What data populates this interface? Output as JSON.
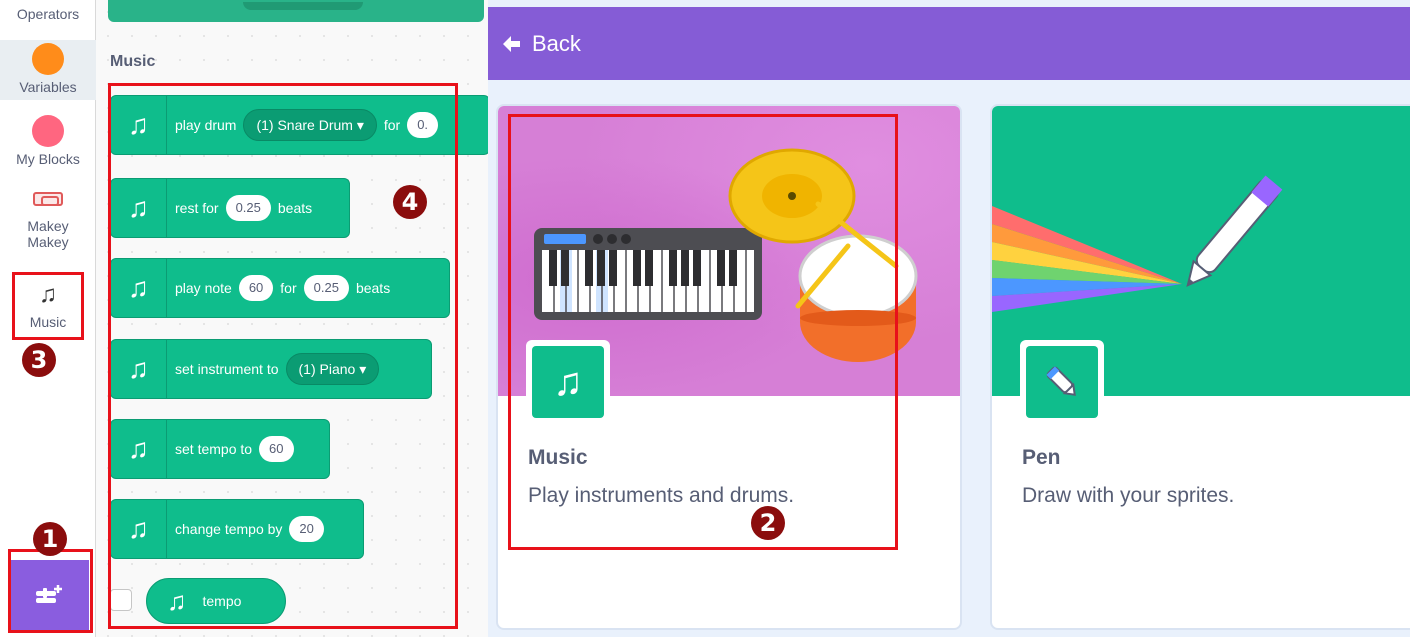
{
  "categories": {
    "operators": {
      "label": "Operators"
    },
    "variables": {
      "label": "Variables",
      "color": "#ff8c1a"
    },
    "my_blocks": {
      "label": "My Blocks",
      "color": "#ff6680"
    },
    "makey_makey": {
      "label": "Makey\nMakey",
      "line1": "Makey",
      "line2": "Makey"
    },
    "music": {
      "label": "Music",
      "icon": "music-notes-icon"
    }
  },
  "palette": {
    "section_heading": "Music",
    "blocks": {
      "play_drum": {
        "label": "play drum",
        "drum": "(1) Snare Drum",
        "for_label": "for",
        "beats_value": "0."
      },
      "rest": {
        "label": "rest for",
        "value": "0.25",
        "suffix": "beats"
      },
      "play_note": {
        "label": "play note",
        "note": "60",
        "for_label": "for",
        "beats_value": "0.25",
        "suffix": "beats"
      },
      "set_instrument": {
        "label": "set instrument to",
        "instrument": "(1) Piano"
      },
      "set_tempo": {
        "label": "set tempo to",
        "value": "60"
      },
      "change_tempo": {
        "label": "change tempo by",
        "value": "20"
      },
      "tempo_reporter": {
        "label": "tempo"
      }
    }
  },
  "library": {
    "back_label": "Back",
    "cards": {
      "music": {
        "title": "Music",
        "description": "Play instruments and drums."
      },
      "pen": {
        "title": "Pen",
        "description": "Draw with your sprites."
      }
    }
  },
  "steps": {
    "one": "1",
    "two": "2",
    "three": "3",
    "four": "4"
  },
  "colors": {
    "accent_purple": "#855cd6",
    "block_green": "#0fbd8c",
    "annotation_red": "#e8111a",
    "badge_maroon": "#8b0d0d"
  }
}
